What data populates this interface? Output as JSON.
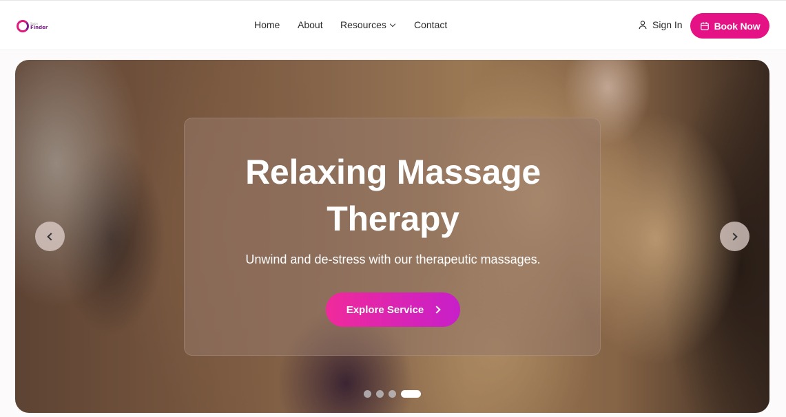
{
  "brand": {
    "logo_small": "Salon",
    "logo_word": "Finder",
    "accent_color": "#e41284"
  },
  "nav": {
    "items": [
      {
        "label": "Home"
      },
      {
        "label": "About"
      },
      {
        "label": "Resources",
        "has_dropdown": true
      },
      {
        "label": "Contact"
      }
    ]
  },
  "header": {
    "sign_in_label": "Sign In",
    "sign_in_icon": "user-icon",
    "book_now_label": "Book Now",
    "book_now_icon": "calendar-icon"
  },
  "hero": {
    "title": "Relaxing Massage Therapy",
    "subtitle": "Unwind and de-stress with our therapeutic massages.",
    "cta_label": "Explore Service",
    "cta_gradient": [
      "#f02a9b",
      "#c71fc9"
    ],
    "prev_icon": "chevron-left-icon",
    "next_icon": "chevron-right-icon",
    "slide_count": 4,
    "active_slide": 4
  }
}
